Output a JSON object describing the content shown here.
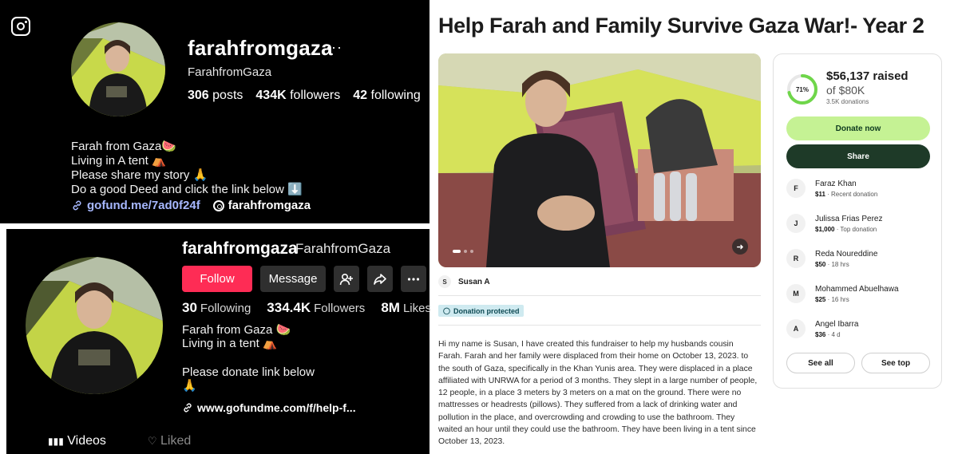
{
  "instagram": {
    "username": "farahfromgaza",
    "more": "···",
    "full_name": "FarahfromGaza",
    "stats": [
      {
        "value": "306",
        "label": "posts"
      },
      {
        "value": "434K",
        "label": "followers"
      },
      {
        "value": "42",
        "label": "following"
      }
    ],
    "bio": [
      "Farah from Gaza🍉",
      "Living in A tent ⛺",
      "Please share my story 🙏",
      "Do a good Deed and click the link below ⬇️"
    ],
    "link": "gofund.me/7ad0f24f",
    "threads": "farahfromgaza"
  },
  "tiktok": {
    "username": "farahfromgaza",
    "nickname": "FarahfromGaza",
    "follow": "Follow",
    "message": "Message",
    "stats": [
      {
        "value": "30",
        "label": "Following"
      },
      {
        "value": "334.4K",
        "label": "Followers"
      },
      {
        "value": "8M",
        "label": "Likes"
      }
    ],
    "bio": [
      "Farah from Gaza 🍉",
      "Living in a tent ⛺"
    ],
    "bio2": [
      "Please donate link below",
      "🙏"
    ],
    "link": "www.gofundme.com/f/help-f...",
    "tabs": {
      "videos": "Videos",
      "liked": "Liked"
    }
  },
  "gofundme": {
    "title": "Help Farah and Family Survive Gaza War!- Year 2",
    "organizer_initial": "S",
    "organizer": "Susan A",
    "protected": "Donation protected",
    "story": "Hi my name is Susan, I have created this fundraiser to help my husbands cousin Farah. Farah and her family were displaced from their home on October 13, 2023. to the south of Gaza, specifically in the Khan Yunis area. They were displaced in a place affiliated with UNRWA for a period of 3 months. They slept in a large number of people, 12 people, in a place 3 meters by 3 meters on a mat on the ground. There were no mattresses or headrests (pillows). They suffered from a lack of drinking water and pollution in the place, and overcrowding and crowding to use the bathroom. They waited an hour until they could use the bathroom. They have been living in a tent since October 13, 2023.",
    "progress_pct": 71,
    "progress_label": "71%",
    "raised": "$56,137 raised",
    "goal": "of $80K",
    "donations": "3.5K donations",
    "donate_label": "Donate now",
    "share_label": "Share",
    "donors": [
      {
        "initial": "F",
        "name": "Faraz Khan",
        "amount": "$11",
        "note": " · Recent donation"
      },
      {
        "initial": "J",
        "name": "Julissa Frias Perez",
        "amount": "$1,000",
        "note": " · Top donation"
      },
      {
        "initial": "R",
        "name": "Reda Noureddine",
        "amount": "$50",
        "note": " · 18 hrs"
      },
      {
        "initial": "M",
        "name": "Mohammed Abuelhawa",
        "amount": "$25",
        "note": " · 16 hrs"
      },
      {
        "initial": "A",
        "name": "Angel Ibarra",
        "amount": "$36",
        "note": " · 4 d"
      }
    ],
    "see_all": "See all",
    "see_top": "See top"
  },
  "colors": {
    "tiktok_follow": "#fe2c55",
    "gfm_green": "#c5f294",
    "gfm_dark": "#1e3a28",
    "ring": "#6fd64a"
  }
}
